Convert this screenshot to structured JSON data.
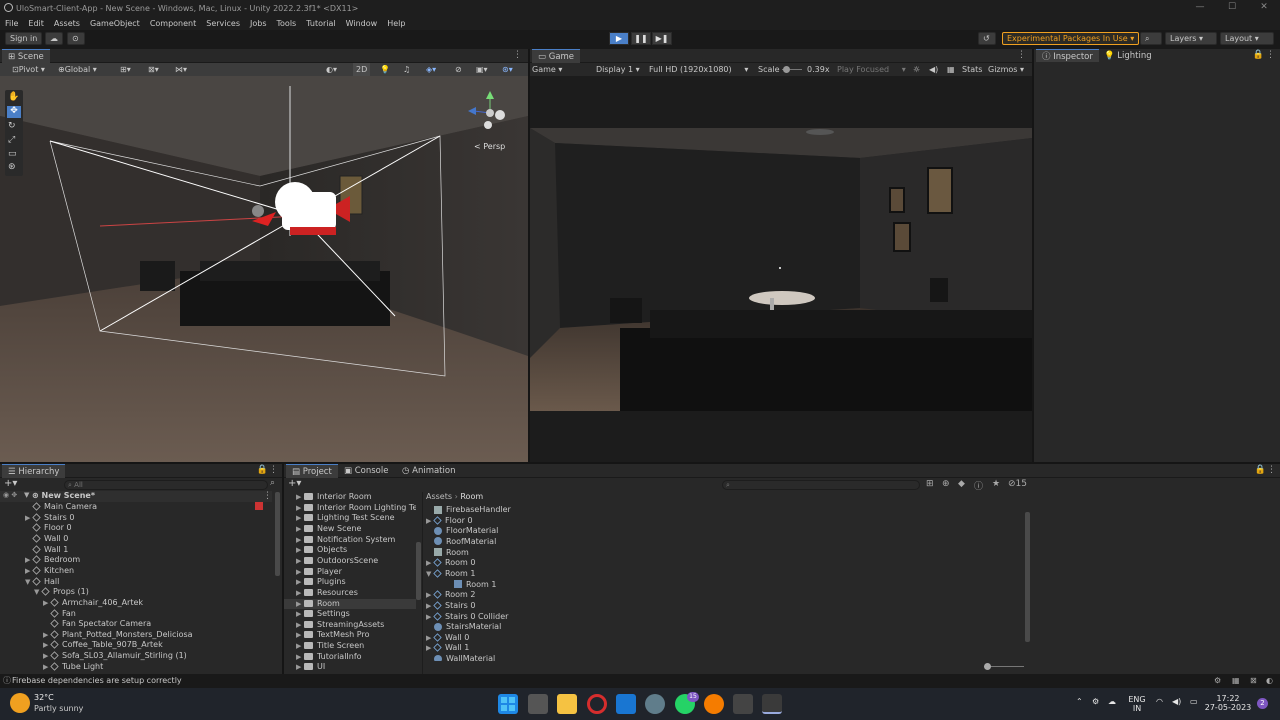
{
  "window": {
    "title": "UloSmart-Client-App - New Scene - Windows, Mac, Linux - Unity 2022.2.3f1* <DX11>"
  },
  "menu": [
    "File",
    "Edit",
    "Assets",
    "GameObject",
    "Component",
    "Services",
    "Jobs",
    "Tools",
    "Tutorial",
    "Window",
    "Help"
  ],
  "toolbar": {
    "sign_in": "Sign in",
    "experimental": "Experimental Packages In Use ▾",
    "layers": "Layers",
    "layout": "Layout"
  },
  "scene_panel": {
    "tab": "Scene",
    "pivot": "Pivot",
    "global": "Global",
    "mode_2d": "2D",
    "persp": "< Persp"
  },
  "game_panel": {
    "tab": "Game",
    "mode": "Game",
    "display": "Display 1",
    "resolution": "Full HD (1920x1080)",
    "scale_label": "Scale",
    "scale_value": "0.39x",
    "play_focused": "Play Focused",
    "stats": "Stats",
    "gizmos": "Gizmos"
  },
  "right_tabs": {
    "inspector": "Inspector",
    "lighting": "Lighting"
  },
  "hierarchy": {
    "tab": "Hierarchy",
    "search_placeholder": "All",
    "scene": "New Scene*",
    "rows": [
      {
        "label": "Main Camera",
        "depth": 1,
        "arrow": ""
      },
      {
        "label": "Stairs 0",
        "depth": 1,
        "arrow": "▶"
      },
      {
        "label": "Floor 0",
        "depth": 1,
        "arrow": ""
      },
      {
        "label": "Wall 0",
        "depth": 1,
        "arrow": ""
      },
      {
        "label": "Wall 1",
        "depth": 1,
        "arrow": ""
      },
      {
        "label": "Bedroom",
        "depth": 1,
        "arrow": "▶"
      },
      {
        "label": "Kitchen",
        "depth": 1,
        "arrow": "▶"
      },
      {
        "label": "Hall",
        "depth": 1,
        "arrow": "▼"
      },
      {
        "label": "Props (1)",
        "depth": 2,
        "arrow": "▼"
      },
      {
        "label": "Armchair_406_Artek",
        "depth": 3,
        "arrow": "▶"
      },
      {
        "label": "Fan",
        "depth": 3,
        "arrow": ""
      },
      {
        "label": "Fan Spectator Camera",
        "depth": 3,
        "arrow": ""
      },
      {
        "label": "Plant_Potted_Monsters_Deliciosa",
        "depth": 3,
        "arrow": "▶"
      },
      {
        "label": "Coffee_Table_907B_Artek",
        "depth": 3,
        "arrow": "▶"
      },
      {
        "label": "Sofa_SL03_Allamuir_Stirling (1)",
        "depth": 3,
        "arrow": "▶"
      },
      {
        "label": "Tube Light",
        "depth": 3,
        "arrow": "▶"
      }
    ]
  },
  "project": {
    "tabs": [
      "Project",
      "Console",
      "Animation"
    ],
    "count": "15",
    "folders": [
      "Interior Room",
      "Interior Room Lighting Test",
      "Lighting Test Scene",
      "New Scene",
      "Notification System",
      "Objects",
      "OutdoorsScene",
      "Player",
      "Plugins",
      "Resources",
      "Room",
      "Settings",
      "StreamingAssets",
      "TextMesh Pro",
      "Title Screen",
      "TutorialInfo",
      "UI"
    ],
    "selected_folder": "Room",
    "breadcrumb": [
      "Assets",
      "Room"
    ],
    "assets": [
      {
        "label": "FirebaseHandler",
        "kind": "script",
        "arrow": ""
      },
      {
        "label": "Floor 0",
        "kind": "prefab",
        "arrow": "▶"
      },
      {
        "label": "FloorMaterial",
        "kind": "material",
        "arrow": ""
      },
      {
        "label": "RoofMaterial",
        "kind": "material",
        "arrow": ""
      },
      {
        "label": "Room",
        "kind": "script",
        "arrow": ""
      },
      {
        "label": "Room 0",
        "kind": "prefab",
        "arrow": "▶"
      },
      {
        "label": "Room 1",
        "kind": "prefab",
        "arrow": "▼"
      },
      {
        "label": "Room 1",
        "kind": "grid",
        "arrow": ""
      },
      {
        "label": "Room 2",
        "kind": "prefab",
        "arrow": "▶"
      },
      {
        "label": "Stairs 0",
        "kind": "prefab",
        "arrow": "▶"
      },
      {
        "label": "Stairs 0 Collider",
        "kind": "prefab",
        "arrow": "▶"
      },
      {
        "label": "StairsMaterial",
        "kind": "material",
        "arrow": ""
      },
      {
        "label": "Wall 0",
        "kind": "prefab",
        "arrow": "▶"
      },
      {
        "label": "Wall 1",
        "kind": "prefab",
        "arrow": "▶"
      },
      {
        "label": "WallMaterial",
        "kind": "material",
        "arrow": ""
      }
    ]
  },
  "status": {
    "message": "Firebase dependencies are setup correctly"
  },
  "taskbar": {
    "temp": "32°C",
    "weather": "Partly sunny",
    "lang1": "ENG",
    "lang2": "IN",
    "time": "17:22",
    "date": "27-05-2023",
    "notif": "2",
    "whatsapp_badge": "15"
  },
  "colors": {
    "accent": "#4a7fc7",
    "panel": "#282828",
    "experimental": "#f0a020"
  }
}
